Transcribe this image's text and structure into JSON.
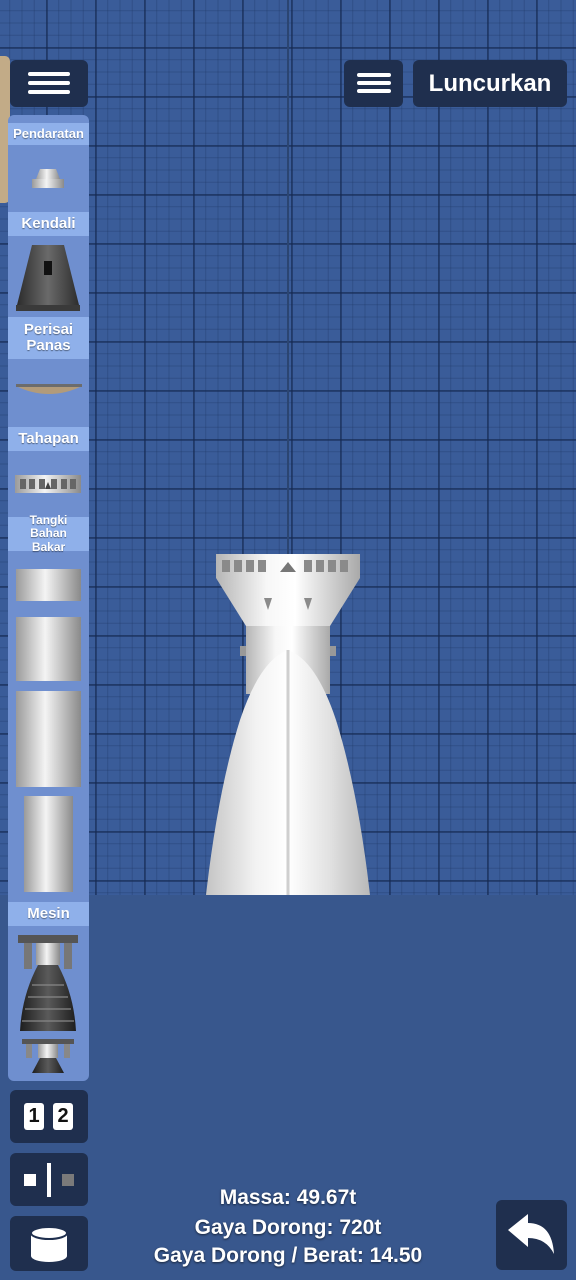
{
  "topbar": {
    "menu_icon": "hamburger-icon",
    "launch_label": "Luncurkan"
  },
  "parts_panel": {
    "categories": [
      {
        "label": "Pendaratan"
      },
      {
        "label": "Kendali"
      },
      {
        "label": "Perisai Panas"
      },
      {
        "label": "Tahapan"
      },
      {
        "label": "Tangki Bahan Bakar"
      },
      {
        "label": "Mesin"
      }
    ]
  },
  "bottom_tools": {
    "stage_numbers": [
      "1",
      "2"
    ],
    "symmetry_icon": "symmetry-icon",
    "fuel_icon": "cylinder-icon",
    "undo_icon": "undo-arrow-icon"
  },
  "stats": {
    "mass": "Massa: 49.67t",
    "thrust": "Gaya Dorong: 720t",
    "twr": "Gaya Dorong / Berat: 14.50"
  }
}
